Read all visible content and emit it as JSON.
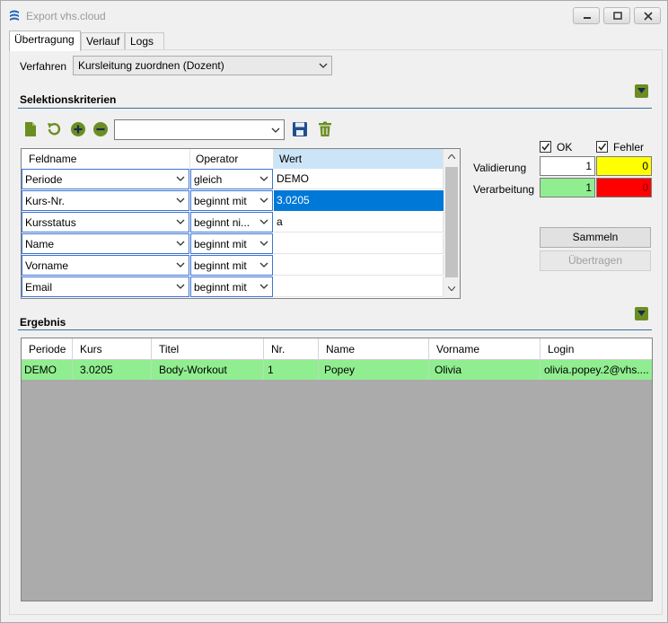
{
  "window": {
    "title": "Export vhs.cloud"
  },
  "tabs": [
    {
      "label": "Übertragung"
    },
    {
      "label": "Verlauf"
    },
    {
      "label": "Logs"
    }
  ],
  "verfahren": {
    "label": "Verfahren",
    "value": "Kursleitung zuordnen (Dozent)"
  },
  "selektion": {
    "title": "Selektionskriterien",
    "columns": [
      "Feldname",
      "Operator",
      "Wert"
    ],
    "rows": [
      {
        "feld": "Periode",
        "operator": "gleich",
        "wert": "DEMO"
      },
      {
        "feld": "Kurs-Nr.",
        "operator": "beginnt mit",
        "wert": "3.0205"
      },
      {
        "feld": "Kursstatus",
        "operator": "beginnt ni...",
        "wert": "a"
      },
      {
        "feld": "Name",
        "operator": "beginnt mit",
        "wert": ""
      },
      {
        "feld": "Vorname",
        "operator": "beginnt mit",
        "wert": ""
      },
      {
        "feld": "Email",
        "operator": "beginnt mit",
        "wert": ""
      }
    ]
  },
  "status": {
    "ok_label": "OK",
    "fehler_label": "Fehler",
    "validierung": {
      "label": "Validierung",
      "ok": "1",
      "fehler": "0"
    },
    "verarbeitung": {
      "label": "Verarbeitung",
      "ok": "1",
      "fehler": "0"
    }
  },
  "buttons": {
    "sammeln": "Sammeln",
    "uebertragen": "Übertragen"
  },
  "ergebnis": {
    "title": "Ergebnis",
    "columns": [
      "Periode",
      "Kurs",
      "Titel",
      "Nr.",
      "Name",
      "Vorname",
      "Login"
    ],
    "rows": [
      [
        "DEMO",
        "3.0205",
        "Body-Workout",
        "1",
        "Popey",
        "Olivia",
        "olivia.popey.2@vhs...."
      ]
    ]
  },
  "colors": {
    "accent": "#0078d7",
    "result_row": "#90ee90",
    "warning": "#ffff00",
    "error": "#ff0000",
    "success": "#90ee90",
    "section_line": "#3c6e9b"
  }
}
